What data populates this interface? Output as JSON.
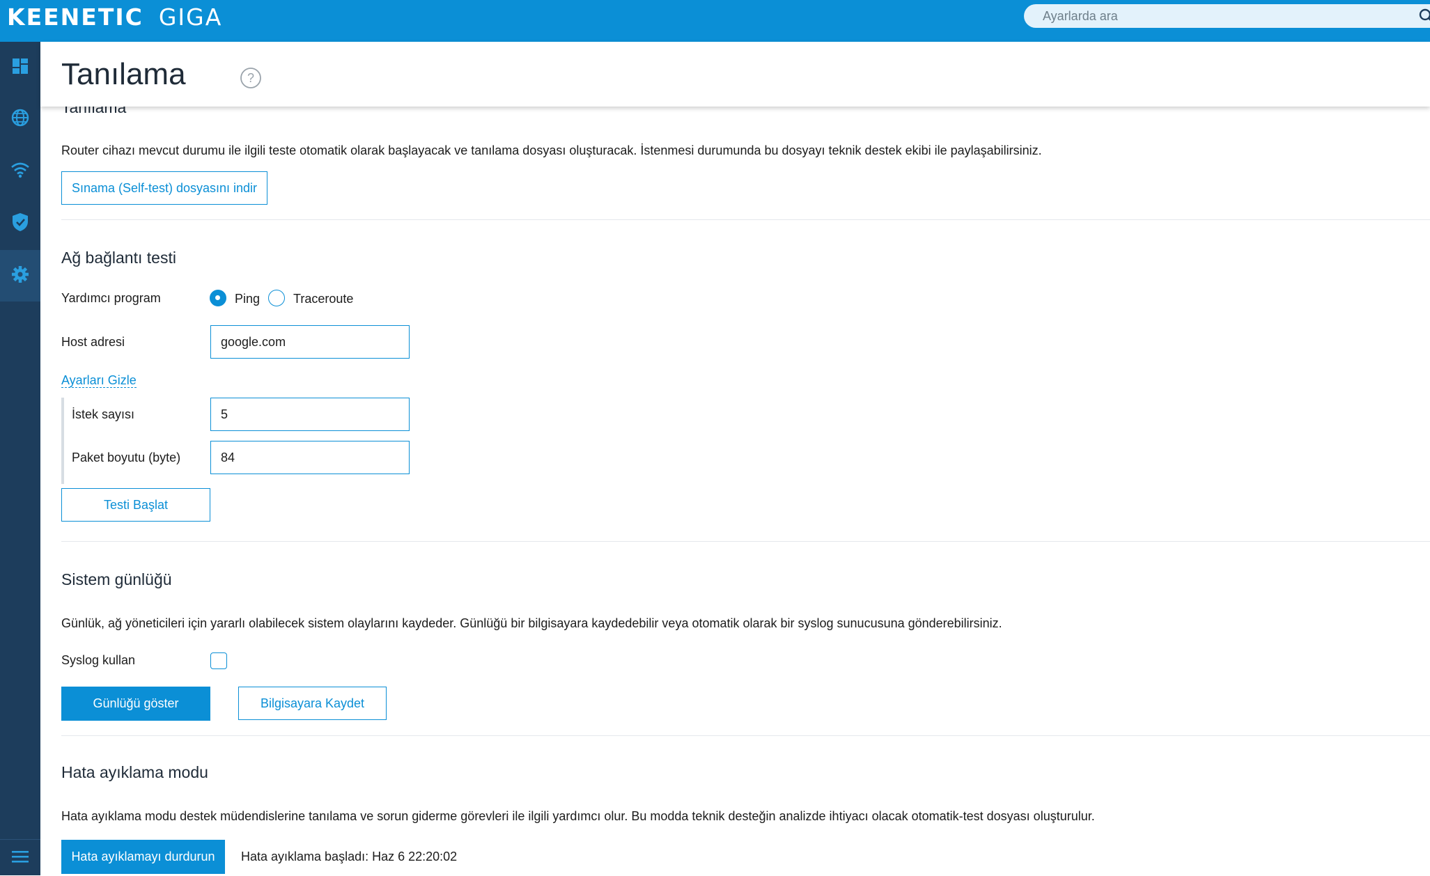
{
  "topbar": {
    "brand": "KEENETIC",
    "model": "GIGA",
    "search_placeholder": "Ayarlarda ara"
  },
  "sidebar": {
    "items": [
      {
        "icon": "dashboard-icon"
      },
      {
        "icon": "globe-icon"
      },
      {
        "icon": "wifi-icon"
      },
      {
        "icon": "shield-icon"
      },
      {
        "icon": "gear-icon",
        "active": true
      }
    ],
    "bottom_icon": "menu-icon"
  },
  "header": {
    "title": "Tanılama"
  },
  "diagnostics": {
    "clipped_title": "Tanılama",
    "description": "Router cihazı mevcut durumu ile ilgili teste otomatik olarak başlayacak ve tanılama dosyası oluşturacak. İstenmesi durumunda bu dosyayı teknik destek ekibi ile paylaşabilirsiniz.",
    "download_button": "Sınama (Self-test) dosyasını indir"
  },
  "network_test": {
    "title": "Ağ bağlantı testi",
    "utility_label": "Yardımcı program",
    "options": [
      {
        "label": "Ping",
        "checked": true
      },
      {
        "label": "Traceroute",
        "checked": false
      }
    ],
    "host_label": "Host adresi",
    "host_value": "google.com",
    "hide_settings_link": "Ayarları Gizle",
    "count_label": "İstek sayısı",
    "count_value": "5",
    "packet_label": "Paket boyutu (byte)",
    "packet_value": "84",
    "start_button": "Testi Başlat"
  },
  "system_log": {
    "title": "Sistem günlüğü",
    "description": "Günlük, ağ yöneticileri için yararlı olabilecek sistem olaylarını kaydeder. Günlüğü bir bilgisayara kaydedebilir veya otomatik olarak bir syslog sunucusuna gönderebilirsiniz.",
    "syslog_label": "Syslog kullan",
    "syslog_checked": false,
    "show_button": "Günlüğü göster",
    "save_button": "Bilgisayara Kaydet"
  },
  "debug_mode": {
    "title": "Hata ayıklama modu",
    "description": "Hata ayıklama modu destek müdendislerine tanılama ve sorun giderme görevleri ile ilgili yardımcı olur. Bu modda teknik desteğin analizde ihtiyacı olacak otomatik-test dosyası oluşturulur.",
    "stop_button": "Hata ayıklamayı durdurun",
    "status_text": "Hata ayıklama başladı: Haz 6 22:20:02"
  },
  "colors": {
    "accent": "#0b8fd6",
    "sidebar": "#1d3d5c",
    "sidebar_icon": "#2a9fe0"
  }
}
